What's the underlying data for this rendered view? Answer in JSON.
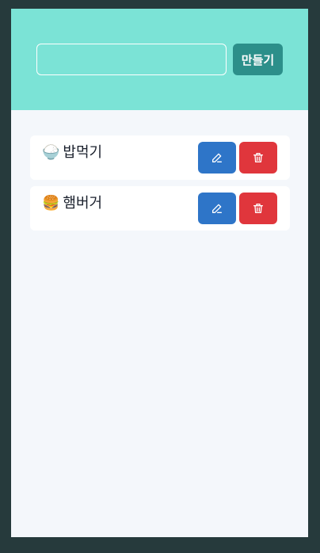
{
  "header": {
    "input": {
      "value": "",
      "placeholder": ""
    },
    "create_label": "만들기"
  },
  "todos": [
    {
      "emoji": "🍚",
      "text": "밥먹기",
      "edit_icon": "pencil-icon",
      "delete_icon": "trash-icon"
    },
    {
      "emoji": "🍔",
      "text": "햄버거",
      "edit_icon": "pencil-icon",
      "delete_icon": "trash-icon"
    }
  ],
  "colors": {
    "frame": "#263a3c",
    "header": "#7be3d6",
    "create_button": "#2c8f8a",
    "body": "#f4f7fb",
    "edit_button": "#2e75c8",
    "delete_button": "#e0363c"
  }
}
